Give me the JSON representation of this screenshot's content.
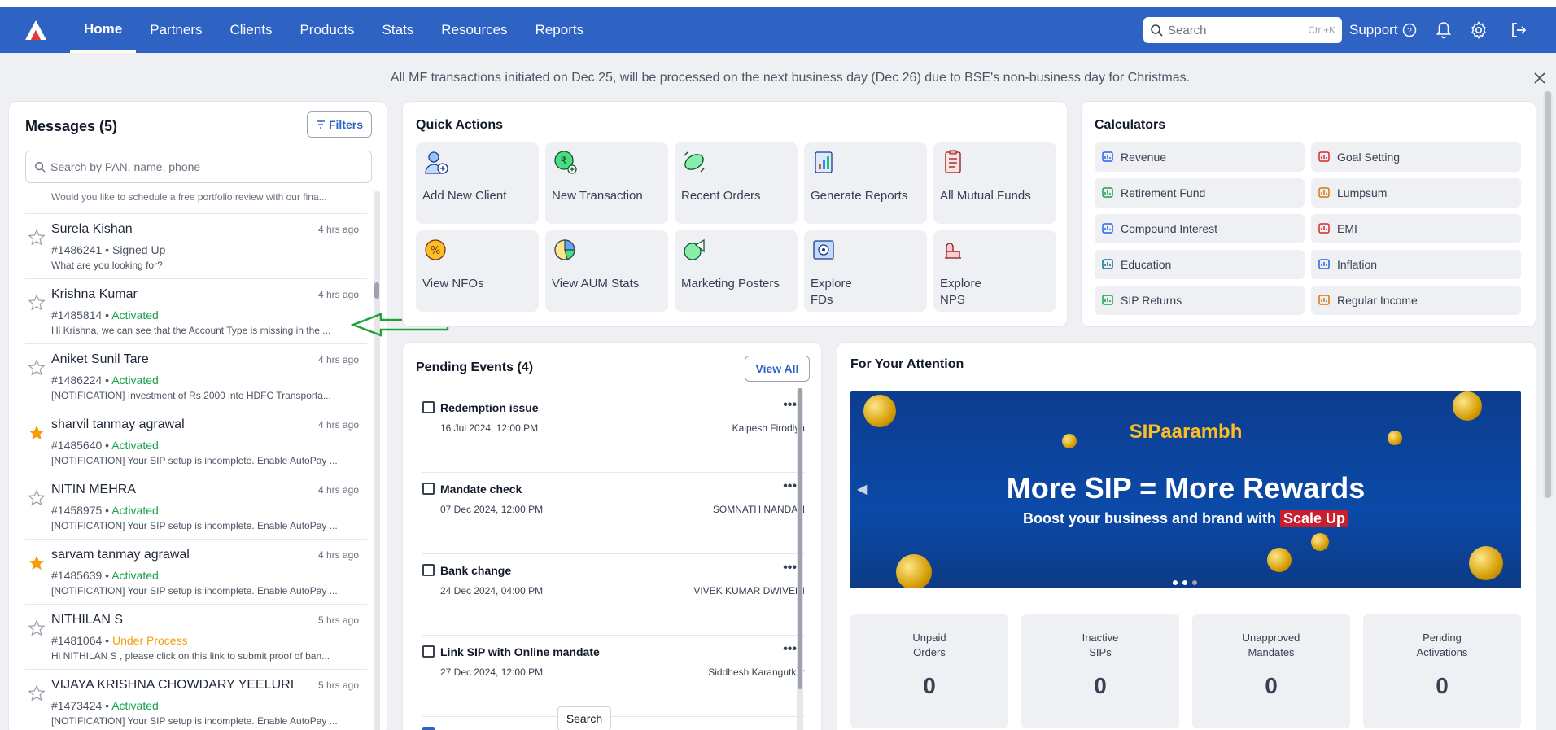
{
  "nav": {
    "items": [
      "Home",
      "Partners",
      "Clients",
      "Products",
      "Stats",
      "Resources",
      "Reports"
    ],
    "search_placeholder": "Search",
    "search_shortcut": "Ctrl+K",
    "support": "Support"
  },
  "banner": {
    "text": "All MF transactions initiated on Dec 25, will be processed on the next business day (Dec 26) due to BSE's non-business day for Christmas."
  },
  "messages": {
    "title": "Messages (5)",
    "filters": "Filters",
    "search_placeholder": "Search by PAN, name, phone",
    "first_preview": "Would you like to schedule a free portfolio review with our fina...",
    "items": [
      {
        "name": "Surela Kishan",
        "time": "4 hrs ago",
        "id": "#1486241",
        "status": "Signed Up",
        "status_type": "plain",
        "text": "What are you looking for?",
        "starred": false
      },
      {
        "name": "Krishna Kumar",
        "time": "4 hrs ago",
        "id": "#1485814",
        "status": "Activated",
        "status_type": "activated",
        "text": "Hi Krishna, we can see that the Account Type is missing in the ...",
        "starred": false
      },
      {
        "name": "Aniket Sunil Tare",
        "time": "4 hrs ago",
        "id": "#1486224",
        "status": "Activated",
        "status_type": "activated",
        "text": "[NOTIFICATION] Investment of Rs 2000 into HDFC Transporta...",
        "starred": false
      },
      {
        "name": "sharvil tanmay agrawal",
        "time": "4 hrs ago",
        "id": "#1485640",
        "status": "Activated",
        "status_type": "activated",
        "text": "[NOTIFICATION] Your SIP setup is incomplete. Enable AutoPay ...",
        "starred": true
      },
      {
        "name": "NITIN MEHRA",
        "time": "4 hrs ago",
        "id": "#1458975",
        "status": "Activated",
        "status_type": "activated",
        "text": "[NOTIFICATION] Your SIP setup is incomplete. Enable AutoPay ...",
        "starred": false
      },
      {
        "name": "sarvam tanmay agrawal",
        "time": "4 hrs ago",
        "id": "#1485639",
        "status": "Activated",
        "status_type": "activated",
        "text": "[NOTIFICATION] Your SIP setup is incomplete. Enable AutoPay ...",
        "starred": true
      },
      {
        "name": "NITHILAN S",
        "time": "5 hrs ago",
        "id": "#1481064",
        "status": "Under Process",
        "status_type": "under",
        "text": "Hi NITHILAN S , please click on this link to submit proof of ban...",
        "starred": false
      },
      {
        "name": "VIJAYA KRISHNA CHOWDARY YEELURI",
        "time": "5 hrs ago",
        "id": "#1473424",
        "status": "Activated",
        "status_type": "activated",
        "text": "[NOTIFICATION] Your SIP setup is incomplete. Enable AutoPay ...",
        "starred": false
      }
    ]
  },
  "quick_actions": {
    "title": "Quick Actions",
    "items": [
      {
        "label": "Add New Client",
        "icon": "add-client-icon"
      },
      {
        "label": "New Transaction",
        "icon": "new-transaction-icon"
      },
      {
        "label": "Recent Orders",
        "icon": "recent-orders-icon"
      },
      {
        "label": "Generate Reports",
        "icon": "reports-icon"
      },
      {
        "label": "All Mutual Funds",
        "icon": "mutual-funds-icon"
      },
      {
        "label": "View NFOs",
        "icon": "nfo-icon"
      },
      {
        "label": "View AUM Stats",
        "icon": "aum-stats-icon"
      },
      {
        "label": "Marketing Posters",
        "icon": "posters-icon"
      },
      {
        "label": "Explore\nFDs",
        "icon": "fd-icon"
      },
      {
        "label": "Explore\nNPS",
        "icon": "nps-icon"
      }
    ]
  },
  "calculators": {
    "title": "Calculators",
    "items": [
      "Revenue",
      "Goal Setting",
      "Retirement Fund",
      "Lumpsum",
      "Compound Interest",
      "EMI",
      "Education",
      "Inflation",
      "SIP Returns",
      "Regular Income"
    ]
  },
  "pending": {
    "title": "Pending Events (4)",
    "view_all": "View All",
    "items": [
      {
        "title": "Redemption issue",
        "date": "16 Jul 2024, 12:00 PM",
        "person": "Kalpesh Firodiya"
      },
      {
        "title": "Mandate check",
        "date": "07 Dec 2024, 12:00 PM",
        "person": "SOMNATH NANDAN"
      },
      {
        "title": "Bank change",
        "date": "24 Dec 2024, 04:00 PM",
        "person": "VIVEK KUMAR DWIVEDI"
      },
      {
        "title": "Link SIP with Online mandate",
        "date": "27 Dec 2024, 12:00 PM",
        "person": "Siddhesh Karangutkar"
      }
    ],
    "tooltip": "Search"
  },
  "attention": {
    "title": "For Your Attention",
    "promo": {
      "brand": "SIPaarambh",
      "headline": "More SIP = More Rewards",
      "sub_prefix": "Boost your business and brand with ",
      "sub_highlight": "Scale Up"
    },
    "stats": [
      {
        "label": "Unpaid\nOrders",
        "value": "0"
      },
      {
        "label": "Inactive\nSIPs",
        "value": "0"
      },
      {
        "label": "Unapproved\nMandates",
        "value": "0"
      },
      {
        "label": "Pending\nActivations",
        "value": "0"
      }
    ]
  }
}
